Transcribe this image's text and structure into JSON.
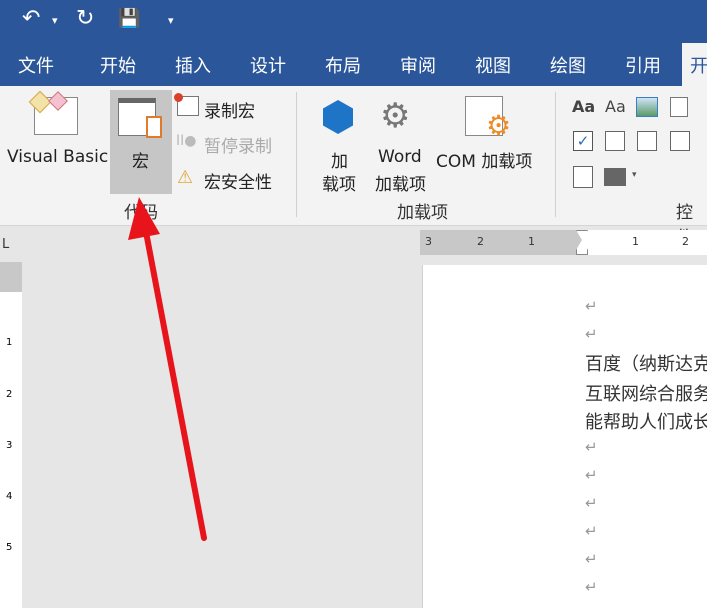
{
  "quick_access": {
    "undo": "↶",
    "undo_arrow": "▾",
    "redo": "↻",
    "save": "💾",
    "customize": "▾"
  },
  "tabs": [
    "文件",
    "开始",
    "插入",
    "设计",
    "布局",
    "审阅",
    "视图",
    "绘图",
    "引用",
    "开"
  ],
  "ribbon": {
    "code_group": {
      "label": "代码",
      "visual_basic": "Visual Basic",
      "macros": "宏",
      "record_macro": "录制宏",
      "pause_recording": "暂停录制",
      "macro_security": "宏安全性"
    },
    "addins_group": {
      "label": "加载项",
      "addins_line1": "加",
      "addins_line2": "载项",
      "word_addins_line1": "Word",
      "word_addins_line2": "加载项",
      "com_addins": "COM 加载项"
    },
    "controls_group": {
      "label": "控件",
      "aa_bold": "Aa",
      "aa_plain": "Aa"
    }
  },
  "ruler": {
    "ticks": [
      "3",
      "2",
      "1",
      "1",
      "2"
    ],
    "corner": "L"
  },
  "vruler": [
    "1",
    "2",
    "3",
    "4",
    "5"
  ],
  "document": {
    "para_mark": "↵",
    "lines": [
      "百度（纳斯达克",
      "互联网综合服务",
      "能帮助人们成长"
    ]
  },
  "colors": {
    "accent": "#2b579a",
    "arrow": "#e8141b"
  }
}
